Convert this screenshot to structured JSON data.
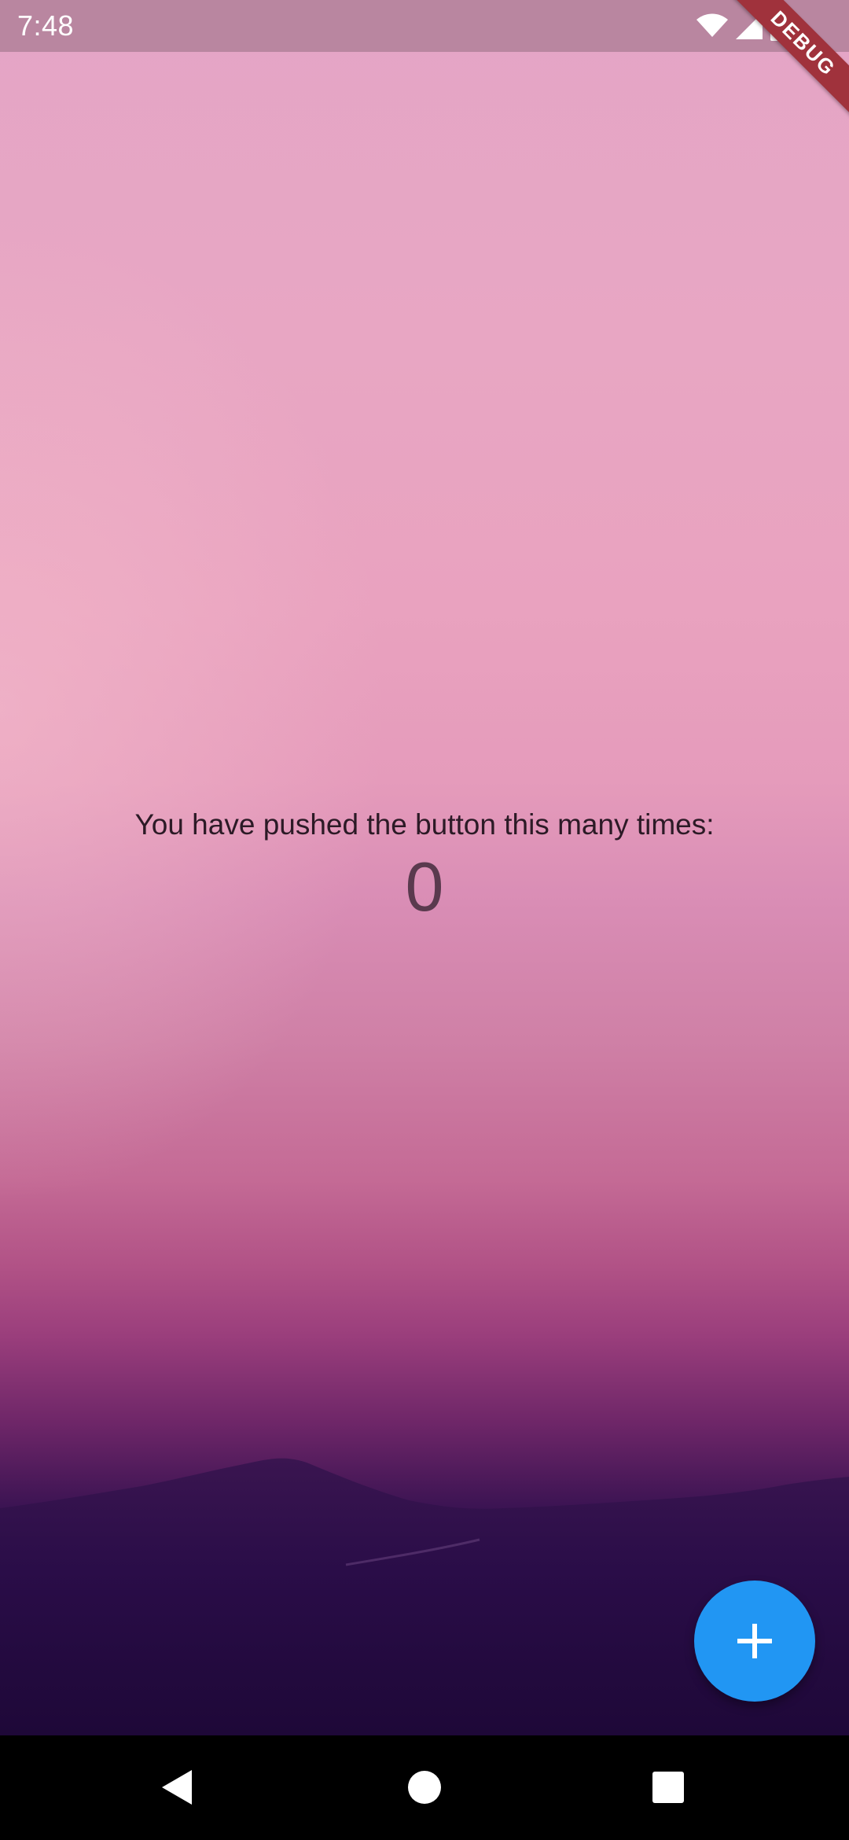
{
  "status_bar": {
    "time": "7:48",
    "icons": [
      "wifi-icon",
      "cellular-signal-icon",
      "battery-icon"
    ]
  },
  "debug_banner": {
    "label": "DEBUG"
  },
  "home": {
    "message": "You have pushed the button this many times:",
    "counter": "0"
  },
  "fab": {
    "icon": "plus-icon",
    "color": "#2196f3"
  },
  "navigation_bar": {
    "buttons": [
      "back-icon",
      "home-icon",
      "recents-icon"
    ]
  }
}
